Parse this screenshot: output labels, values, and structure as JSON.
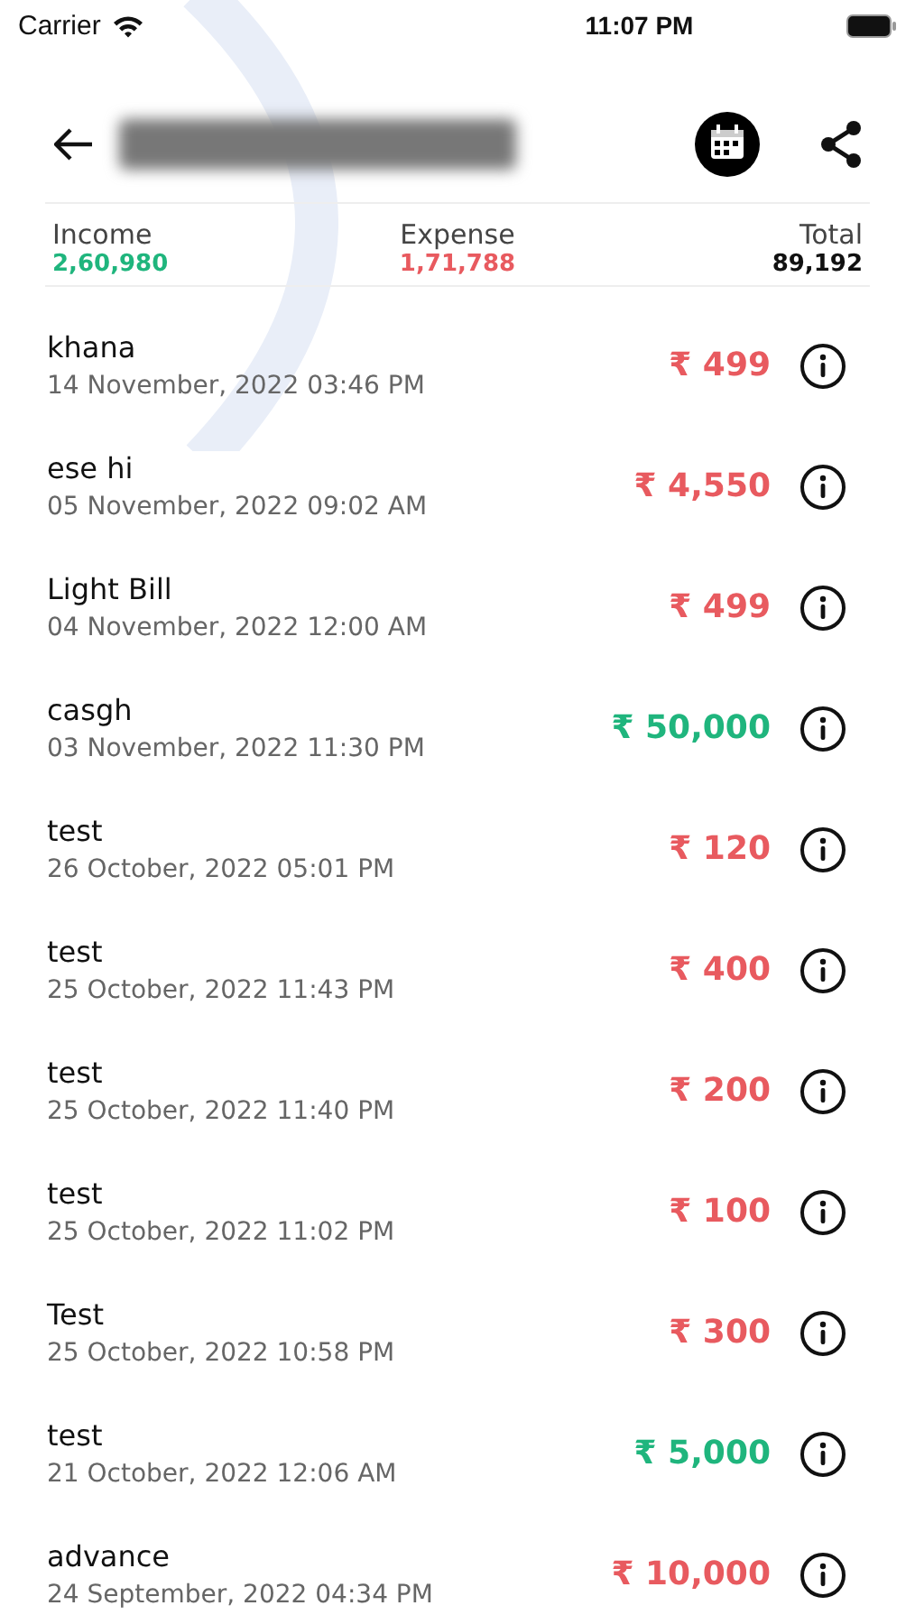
{
  "status_bar": {
    "carrier": "Carrier",
    "time": "11:07 PM"
  },
  "summary": {
    "income_label": "Income",
    "income": "2,60,980",
    "expense_label": "Expense",
    "expense": "1,71,788",
    "total_label": "Total",
    "total": "89,192"
  },
  "transactions": [
    {
      "title": "khana",
      "date": "14 November, 2022 03:46 PM",
      "amount": "₹ 499",
      "kind": "expense"
    },
    {
      "title": "ese hi",
      "date": "05 November, 2022 09:02 AM",
      "amount": "₹ 4,550",
      "kind": "expense"
    },
    {
      "title": "Light Bill",
      "date": "04 November, 2022 12:00 AM",
      "amount": "₹ 499",
      "kind": "expense"
    },
    {
      "title": "casgh",
      "date": "03 November, 2022 11:30 PM",
      "amount": "₹ 50,000",
      "kind": "income"
    },
    {
      "title": "test",
      "date": "26 October, 2022 05:01 PM",
      "amount": "₹ 120",
      "kind": "expense"
    },
    {
      "title": "test",
      "date": "25 October, 2022 11:43 PM",
      "amount": "₹ 400",
      "kind": "expense"
    },
    {
      "title": "test",
      "date": "25 October, 2022 11:40 PM",
      "amount": "₹ 200",
      "kind": "expense"
    },
    {
      "title": "test",
      "date": "25 October, 2022 11:02 PM",
      "amount": "₹ 100",
      "kind": "expense"
    },
    {
      "title": "Test",
      "date": "25 October, 2022 10:58 PM",
      "amount": "₹ 300",
      "kind": "expense"
    },
    {
      "title": "test",
      "date": "21 October, 2022 12:06 AM",
      "amount": "₹ 5,000",
      "kind": "income"
    },
    {
      "title": "advance",
      "date": "24 September, 2022 04:34 PM",
      "amount": "₹ 10,000",
      "kind": "expense"
    }
  ]
}
